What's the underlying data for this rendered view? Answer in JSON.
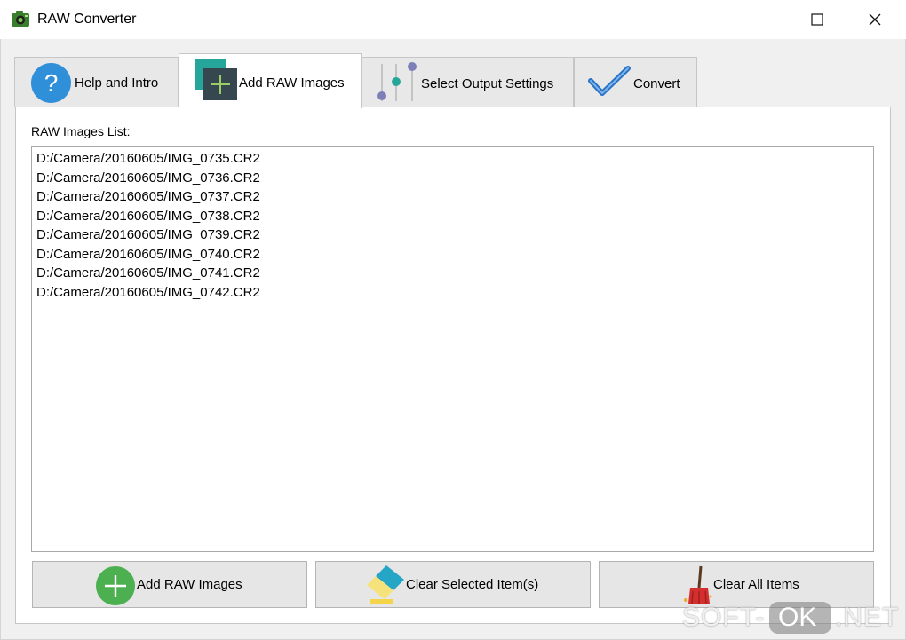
{
  "window": {
    "title": "RAW Converter"
  },
  "tabs": [
    {
      "label": "Help and Intro",
      "icon": "help-icon",
      "active": false
    },
    {
      "label": "Add RAW Images",
      "icon": "add-images-icon",
      "active": true
    },
    {
      "label": "Select Output Settings",
      "icon": "sliders-icon",
      "active": false
    },
    {
      "label": "Convert",
      "icon": "checkmark-icon",
      "active": false
    }
  ],
  "main": {
    "list_label": "RAW Images List:",
    "items": [
      "D:/Camera/20160605/IMG_0735.CR2",
      "D:/Camera/20160605/IMG_0736.CR2",
      "D:/Camera/20160605/IMG_0737.CR2",
      "D:/Camera/20160605/IMG_0738.CR2",
      "D:/Camera/20160605/IMG_0739.CR2",
      "D:/Camera/20160605/IMG_0740.CR2",
      "D:/Camera/20160605/IMG_0741.CR2",
      "D:/Camera/20160605/IMG_0742.CR2"
    ]
  },
  "buttons": {
    "add": {
      "label": "Add RAW Images",
      "icon": "plus-circle-icon"
    },
    "clear_selected": {
      "label": "Clear Selected Item(s)",
      "icon": "eraser-icon"
    },
    "clear_all": {
      "label": "Clear All Items",
      "icon": "broom-icon"
    }
  },
  "watermark": {
    "part1": "SOFT-",
    "part2": "OK",
    "part3": ".NET"
  },
  "colors": {
    "help_blue": "#2f8fd9",
    "add_green": "#4caf50",
    "teal": "#26a69a",
    "dark_slate": "#37474f",
    "check_blue": "#2a74c8"
  }
}
